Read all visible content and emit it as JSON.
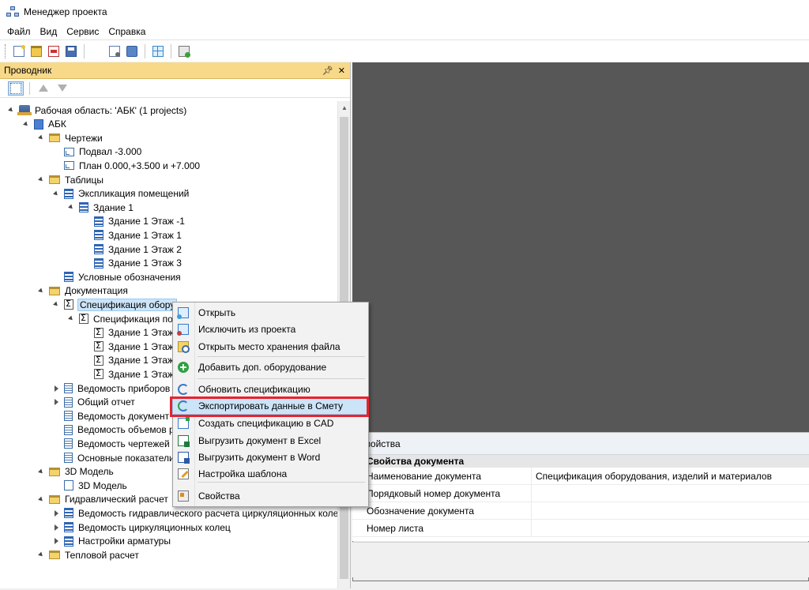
{
  "window": {
    "title": "Менеджер проекта"
  },
  "menu": [
    "Файл",
    "Вид",
    "Сервис",
    "Справка"
  ],
  "explorer": {
    "title": "Проводник",
    "pin_icon": "pin-icon",
    "close_icon": "close-icon",
    "tree": [
      {
        "label": "Рабочая область: 'АБК' (1 projects)",
        "icon": "workspace",
        "expander": "open"
      },
      {
        "label": "АБК",
        "icon": "project",
        "expander": "open"
      },
      {
        "label": "Чертежи",
        "icon": "folder",
        "expander": "open"
      },
      {
        "label": "Подвал -3.000",
        "icon": "drawing",
        "expander": "none"
      },
      {
        "label": "План 0.000,+3.500 и +7.000",
        "icon": "drawing",
        "expander": "none"
      },
      {
        "label": "Таблицы",
        "icon": "folder",
        "expander": "open"
      },
      {
        "label": "Экспликация помещений",
        "icon": "table",
        "expander": "open"
      },
      {
        "label": "Здание 1",
        "icon": "table",
        "expander": "open"
      },
      {
        "label": "Здание 1 Этаж -1",
        "icon": "table",
        "expander": "none"
      },
      {
        "label": "Здание 1 Этаж 1",
        "icon": "table",
        "expander": "none"
      },
      {
        "label": "Здание 1 Этаж 2",
        "icon": "table",
        "expander": "none"
      },
      {
        "label": "Здание 1 Этаж 3",
        "icon": "table",
        "expander": "none"
      },
      {
        "label": "Условные обозначения",
        "icon": "table",
        "expander": "none"
      },
      {
        "label": "Документация",
        "icon": "folder",
        "expander": "open"
      },
      {
        "label": "Спецификация обору",
        "icon": "sigma",
        "expander": "open",
        "selected": true
      },
      {
        "label": "Спецификация по",
        "icon": "sigma",
        "expander": "open"
      },
      {
        "label": "Здание 1 Этаж",
        "icon": "sigma",
        "expander": "none"
      },
      {
        "label": "Здание 1 Этаж",
        "icon": "sigma",
        "expander": "none"
      },
      {
        "label": "Здание 1 Этаж",
        "icon": "sigma",
        "expander": "none"
      },
      {
        "label": "Здание 1 Этаж",
        "icon": "sigma",
        "expander": "none"
      },
      {
        "label": "Ведомость приборов",
        "icon": "doc",
        "expander": "closed"
      },
      {
        "label": "Общий отчет",
        "icon": "doc",
        "expander": "closed"
      },
      {
        "label": "Ведомость документ",
        "icon": "doc",
        "expander": "none"
      },
      {
        "label": "Ведомость объемов р",
        "icon": "doc",
        "expander": "none"
      },
      {
        "label": "Ведомость чертежей",
        "icon": "doc",
        "expander": "none"
      },
      {
        "label": "Основные показатели",
        "icon": "doc",
        "expander": "none"
      },
      {
        "label": "3D Модель",
        "icon": "folder",
        "expander": "open"
      },
      {
        "label": "3D Модель",
        "icon": "model",
        "expander": "none"
      },
      {
        "label": "Гидравлический расчет",
        "icon": "folder",
        "expander": "open"
      },
      {
        "label": "Ведомость гидравлического расчета циркуляционных коле",
        "icon": "table",
        "expander": "closed"
      },
      {
        "label": "Ведомость циркуляционных колец",
        "icon": "table",
        "expander": "closed"
      },
      {
        "label": "Настройки арматуры",
        "icon": "table",
        "expander": "closed"
      },
      {
        "label": "Тепловой расчет",
        "icon": "folder",
        "expander": "open"
      }
    ]
  },
  "context_menu": {
    "items": [
      {
        "label": "Открыть",
        "icon": "doc-blue"
      },
      {
        "label": "Исключить из проекта",
        "icon": "doc-exclude"
      },
      {
        "label": "Открыть место хранения файла",
        "icon": "folder-find"
      },
      {
        "label": "Добавить доп. оборудование",
        "icon": "plus-green"
      },
      {
        "label": "Обновить спецификацию",
        "icon": "refresh"
      },
      {
        "label": "Экспортировать данные в Смету",
        "icon": "export-smeta",
        "highlighted": true
      },
      {
        "label": "Создать спецификацию в CAD",
        "icon": "cad"
      },
      {
        "label": "Выгрузить документ в Excel",
        "icon": "excel"
      },
      {
        "label": "Выгрузить документ в Word",
        "icon": "word"
      },
      {
        "label": "Настройка шаблона",
        "icon": "pencil"
      },
      {
        "label": "Свойства",
        "icon": "props-ico"
      }
    ]
  },
  "properties": {
    "title": "Свойства",
    "section": "Свойства документа",
    "rows": [
      {
        "name": "Наименование документа",
        "value": "Спецификация оборудования, изделий и материалов"
      },
      {
        "name": "Порядковый номер документа",
        "value": ""
      },
      {
        "name": "Обозначение документа",
        "value": ""
      },
      {
        "name": "Номер листа",
        "value": ""
      }
    ]
  },
  "colors": {
    "panel_header": "#f8d98a",
    "highlight_frame": "#e8222c",
    "selection": "#cce4f7",
    "dark_area": "#575757"
  }
}
